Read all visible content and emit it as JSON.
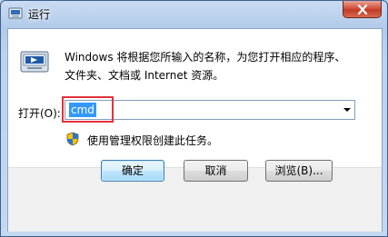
{
  "window": {
    "title": "运行",
    "close_glyph": "✕"
  },
  "icons": {
    "title": "run-icon",
    "main": "run-program-icon",
    "shield": "uac-shield-icon",
    "close": "close-icon",
    "dropdown": "chevron-down-icon"
  },
  "dialog": {
    "description_line1": "Windows 将根据您所输入的名称，为您打开相应的程序、",
    "description_line2": "文件夹、文档或 Internet 资源。",
    "open_label": "打开(O):",
    "input_value": "cmd",
    "admin_note": "使用管理权限创建此任务。"
  },
  "buttons": {
    "ok": "确定",
    "cancel": "取消",
    "browse": "浏览(B)..."
  },
  "colors": {
    "highlight_border": "#e0323c",
    "selection": "#3399ff",
    "close_button": "#c23a26"
  }
}
